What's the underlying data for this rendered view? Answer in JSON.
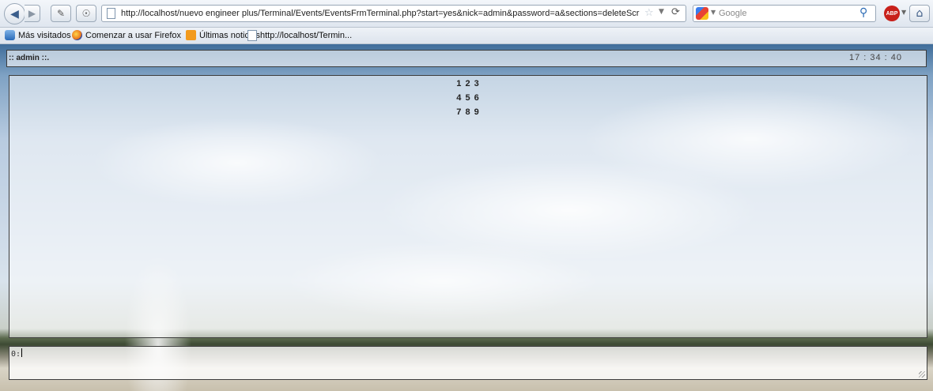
{
  "browser": {
    "url": "http://localhost/nuevo engineer plus/Terminal/Events/EventsFrmTerminal.php?start=yes&nick=admin&password=a&sections=deleteScriptJS_unRegiste",
    "search_placeholder": "Google",
    "icons": {
      "back": "back-arrow-icon",
      "forward": "forward-arrow-icon",
      "star": "bookmark-star-icon",
      "reload": "reload-icon",
      "search": "magnifier-icon",
      "home": "home-icon"
    },
    "abp_label": "ABP"
  },
  "bookmarks": [
    {
      "label": "Más visitados"
    },
    {
      "label": "Comenzar a usar Firefox"
    },
    {
      "label": "Últimas noticias"
    },
    {
      "label": "http://localhost/Termin..."
    }
  ],
  "page": {
    "user_label": ":: admin ::.",
    "clock": "17 : 34 : 40",
    "keypad_rows": [
      "1 2 3",
      "4 5 6",
      "7 8 9"
    ],
    "input_label": "0:"
  }
}
